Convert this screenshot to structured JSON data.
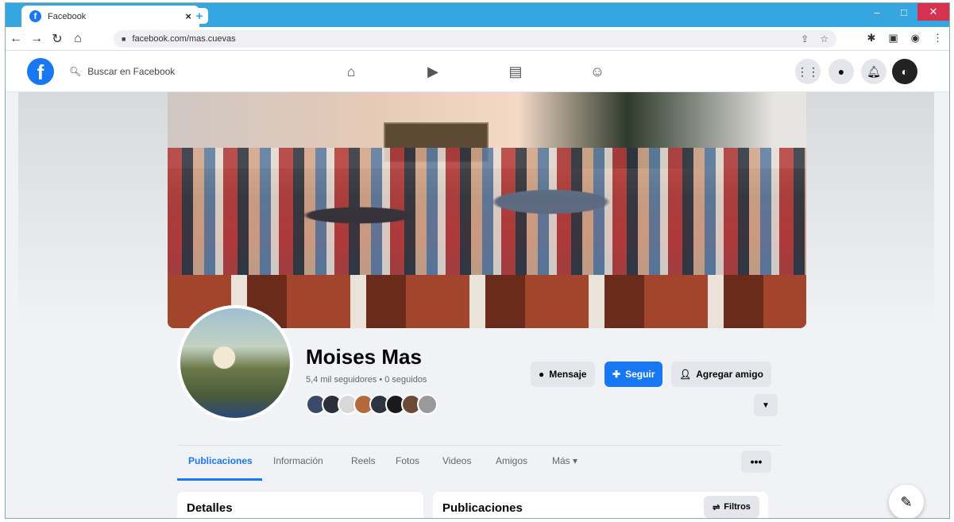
{
  "browser": {
    "tab_title": "Facebook",
    "tab_close": "×",
    "new_tab": "+",
    "url": "facebook.com/mas.cuevas",
    "window_controls": {
      "minimize": "–",
      "maximize": "□",
      "close": "✕"
    }
  },
  "fb": {
    "logo": "f",
    "search_placeholder": "Buscar en Facebook",
    "nav_icons": [
      "home-icon",
      "watch-icon",
      "marketplace-icon",
      "groups-icon"
    ],
    "right_icons": [
      "menu-grid-icon",
      "messenger-icon",
      "notifications-icon",
      "account-icon"
    ]
  },
  "profile": {
    "name": "Moises Mas",
    "followers": "5,4 mil seguidores • 0 seguidos",
    "friend_avatar_colors": [
      "#3b4a6b",
      "#2b2f3a",
      "#d8d8d8",
      "#b5683a",
      "#2d3340",
      "#1a1a1a",
      "#6b4a3a",
      "#9a9a9a"
    ],
    "buttons": {
      "message": "Mensaje",
      "follow": "Seguir",
      "add_friend": "Agregar amigo"
    }
  },
  "tabs": [
    {
      "label": "Publicaciones",
      "active": true
    },
    {
      "label": "Información",
      "active": false
    },
    {
      "label": "Reels",
      "active": false
    },
    {
      "label": "Fotos",
      "active": false
    },
    {
      "label": "Videos",
      "active": false
    },
    {
      "label": "Amigos",
      "active": false
    },
    {
      "label": "Más ▾",
      "active": false
    }
  ],
  "sections": {
    "details_title": "Detalles",
    "posts_title": "Publicaciones",
    "filters_label": "Filtros"
  },
  "colors": {
    "brand": "#1877f2",
    "chrome_blue": "#35a6e0"
  }
}
